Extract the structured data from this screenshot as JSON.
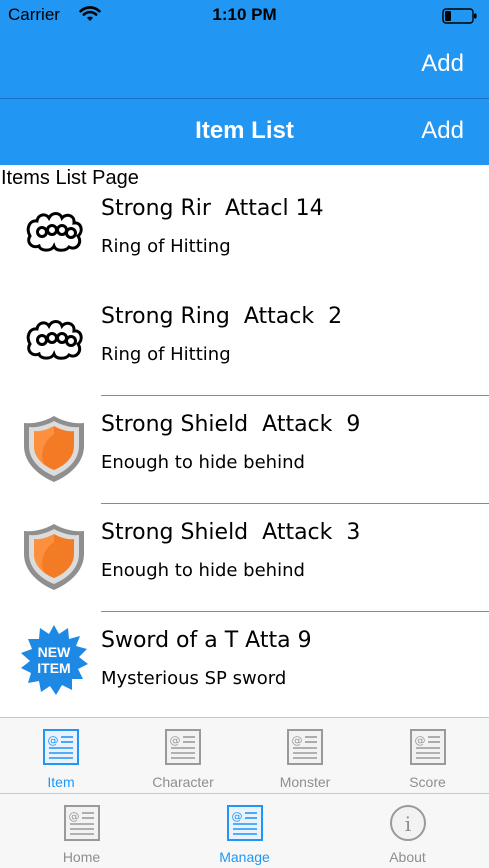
{
  "status_bar": {
    "carrier": "Carrier",
    "time": "1:10 PM"
  },
  "top_nav": {
    "add_label": "Add"
  },
  "nav": {
    "title": "Item List",
    "add_label": "Add"
  },
  "page": {
    "label": "Items List Page"
  },
  "items": [
    {
      "name": "Strong Rir",
      "attribute": "Attacl",
      "value": "14",
      "description": "Ring of Hitting",
      "icon": "knuckles-icon"
    },
    {
      "name": "Strong Ring",
      "attribute": "Attack",
      "value": "2",
      "description": "Ring of Hitting",
      "icon": "knuckles-icon"
    },
    {
      "name": "Strong Shield",
      "attribute": "Attack",
      "value": "9",
      "description": "Enough to hide behind",
      "icon": "shield-icon"
    },
    {
      "name": "Strong Shield",
      "attribute": "Attack",
      "value": "3",
      "description": "Enough to hide behind",
      "icon": "shield-icon"
    },
    {
      "name": "Sword of a T",
      "attribute": "Atta",
      "value": "9",
      "description": "Mysterious SP sword",
      "icon": "new-item-badge-icon",
      "badge_text": [
        "NEW",
        "ITEM"
      ]
    }
  ],
  "tabs_top": [
    {
      "label": "Item",
      "icon": "page-icon",
      "active": true
    },
    {
      "label": "Character",
      "icon": "page-icon",
      "active": false
    },
    {
      "label": "Monster",
      "icon": "page-icon",
      "active": false
    },
    {
      "label": "Score",
      "icon": "page-icon",
      "active": false
    }
  ],
  "tabs_bottom": [
    {
      "label": "Home",
      "icon": "page-icon",
      "active": false
    },
    {
      "label": "Manage",
      "icon": "page-icon",
      "active": true
    },
    {
      "label": "About",
      "icon": "info-icon",
      "active": false
    }
  ],
  "colors": {
    "accent": "#2196f3",
    "inactive": "#8e8e93",
    "shield": "#f47b25",
    "badge": "#1e88e5"
  }
}
